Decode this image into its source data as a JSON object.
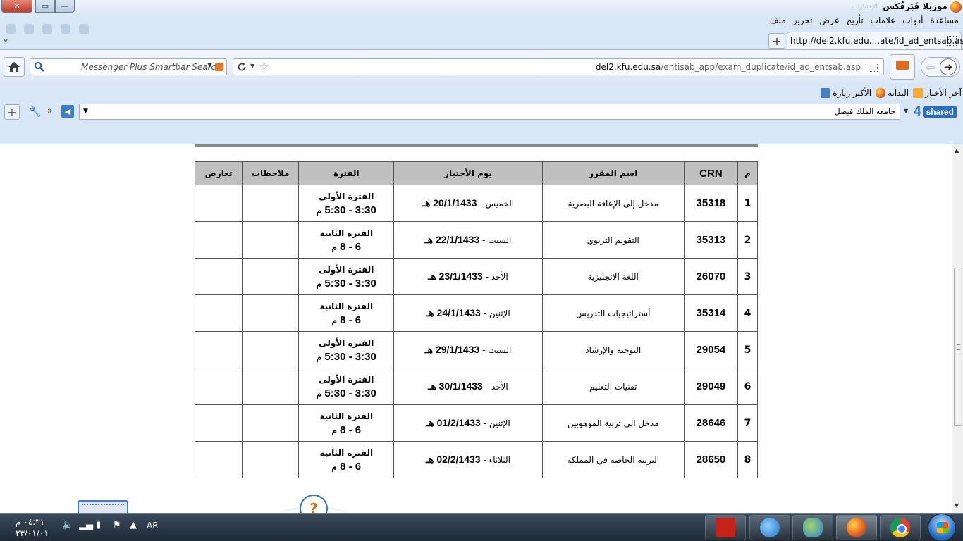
{
  "window": {
    "title": "موزيلا فَيَرفُكس",
    "faded_tab_text": "نموذج الإختبارات"
  },
  "menubar": {
    "items": [
      "ملف",
      "تحرير",
      "عرض",
      "تأريخ",
      "علامات",
      "أدوات",
      "مساعدة"
    ]
  },
  "tab": {
    "title": "http://del2.kfu.edu....ate/id_ad_entsab.asp",
    "new_tab_label": "+"
  },
  "navbar": {
    "search_placeholder": "Messenger Plus Smartbar Search",
    "url_domain": "del2.kfu.edu.sa",
    "url_path": "/entisab_app/exam_duplicate/id_ad_entsab.asp"
  },
  "bookmarks": {
    "items": [
      {
        "label": "الأكثر زيارة",
        "icon": "most-visited-icon"
      },
      {
        "label": "البداية",
        "icon": "firefox-icon"
      },
      {
        "label": "آخر الأخبار",
        "icon": "rss-icon"
      }
    ]
  },
  "toolbar2": {
    "combo_value": "جامعه الملك فيصل",
    "brand_number": "4",
    "brand_name": "shared"
  },
  "table": {
    "headers": [
      "م",
      "CRN",
      "اسم المقرر",
      "يوم الأختبار",
      "الفترة",
      "ملاحظات",
      "تعارض"
    ],
    "rows": [
      {
        "m": "1",
        "crn": "35318",
        "course": "مدخل إلى الإعاقة البصرية",
        "day": "الخميس",
        "date": "20/1/1433",
        "date_suffix": "هـ",
        "period": "الفترة الأولى",
        "time": "3:30 - 5:30",
        "time_suffix": "م",
        "notes": "",
        "conflict": ""
      },
      {
        "m": "2",
        "crn": "35313",
        "course": "التقويم التربوي",
        "day": "السبت",
        "date": "22/1/1433",
        "date_suffix": "هـ",
        "period": "الفترة الثانية",
        "time": "6 - 8",
        "time_suffix": "م",
        "notes": "",
        "conflict": ""
      },
      {
        "m": "3",
        "crn": "26070",
        "course": "اللغة الانجليزية",
        "day": "الأحد",
        "date": "23/1/1433",
        "date_suffix": "هـ",
        "period": "الفترة الأولى",
        "time": "3:30 - 5:30",
        "time_suffix": "م",
        "notes": "",
        "conflict": ""
      },
      {
        "m": "4",
        "crn": "35314",
        "course": "أستراتيجيات التدريس",
        "day": "الإثنين",
        "date": "24/1/1433",
        "date_suffix": "هـ",
        "period": "الفترة الثانية",
        "time": "6 - 8",
        "time_suffix": "م",
        "notes": "",
        "conflict": ""
      },
      {
        "m": "5",
        "crn": "29054",
        "course": "التوجيه والإرشاد",
        "day": "السبت",
        "date": "29/1/1433",
        "date_suffix": "هـ",
        "period": "الفترة الأولى",
        "time": "3:30 - 5:30",
        "time_suffix": "م",
        "notes": "",
        "conflict": ""
      },
      {
        "m": "6",
        "crn": "29049",
        "course": "تقنيات التعليم",
        "day": "الأحد",
        "date": "30/1/1433",
        "date_suffix": "هـ",
        "period": "الفترة الأولى",
        "time": "3:30 - 5:30",
        "time_suffix": "م",
        "notes": "",
        "conflict": ""
      },
      {
        "m": "7",
        "crn": "28646",
        "course": "مدخل الى تربية الموهوبين",
        "day": "الإثنين",
        "date": "01/2/1433",
        "date_suffix": "هـ",
        "period": "الفترة الثانية",
        "time": "6 - 8",
        "time_suffix": "م",
        "notes": "",
        "conflict": ""
      },
      {
        "m": "8",
        "crn": "28650",
        "course": "التربية الخاصة في المملكة",
        "day": "الثلاثاء",
        "date": "02/2/1433",
        "date_suffix": "هـ",
        "period": "الفترة الثانية",
        "time": "6 - 8",
        "time_suffix": "م",
        "notes": "",
        "conflict": ""
      }
    ]
  },
  "taskbar": {
    "time": "٠٤:٣١ م",
    "date": "٢٣/٠١/٠١",
    "language": "AR",
    "apps": [
      "pdf-icon",
      "internet-explorer-icon",
      "messenger-icon",
      "firefox-icon",
      "chrome-icon"
    ]
  }
}
